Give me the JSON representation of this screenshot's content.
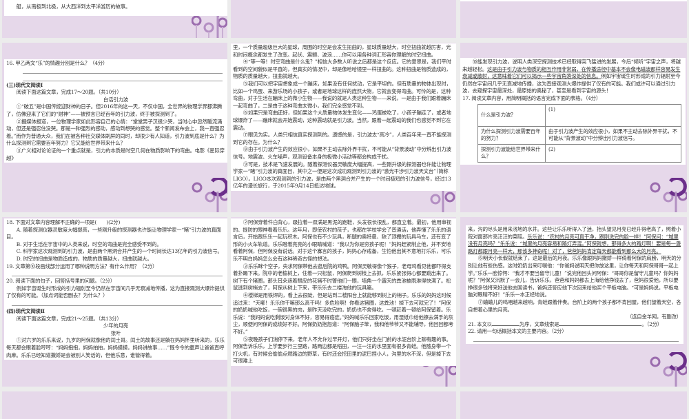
{
  "slides": {
    "s0a": {
      "text": "艇，从南极到北极，从大西洋到太平洋游历的故事。"
    },
    "s1a": {
      "q16": "16. 甲乙两文“乐”的情趣分别是什么？（4分）",
      "section": "(三)现代文阅读Ⅰ",
      "intro": "阅读下面这篇文章，完成17～20题。（共10分）",
      "title": "白话引力波",
      "p1": "①“破五”是中国传统迎财神的日子。但2016年的这一天，不仅中国，全世界的物理学界都沸腾了，仿佛迎来了它们的“财神”——被预言已经百年的引力波，终于被探测到了。",
      "p2": "②据媒体报道，一位物理学家如此形容自己的心情：“堂堂男子汉很少哭，当时心中忽然暖流涌动，但还是强忍住没哭。那是一种强烈的感动，感动到想哭的感觉。整个新闻发布会上，我一直强忍着。”而作为普通大众，我们在被各种社交媒体刷屏的同时，却很少有人知道，引力波到底是什么？为什么探测到它需要百年努力？它又能给世界带来什么？",
      "p3": "③广义相对论论证的一个重点就是，引力的本质是时空几何在物质影响下的弯曲。电影《星际穿越》"
    },
    "s1b": {
      "p0": "里，一个质量超级巨大的星球，周围的时空是会发生扭曲的，星球质量越大，时空扭曲就越厉害，光和时间概念都发生了改变。起伏、震颤、波浪……你可以用各种词汇形容你理解的时空扭曲。",
      "p4": "④“等一等！时空弯曲是什么鬼？”相信大多数人听说之后都是这个反应。它的意思是，我们平时看到的空间貌似是平直的，但真实的情况中，却是像哈哈镜里一样扭曲的。这种扭曲是物质造成的，物质的质量越大，扭曲就越大。",
      "p5": "⑤我们可以把宇宙想象成一个蹦床，如果没有任何扰动，它是平坦的。但有质量的物体出现时，比如一个鸡蛋、来游乐场的小孩子，或者是地球这样的庞然大物，它就会变得弯曲。可怜的是，这种弯曲，对于生活在蹦床上的微小生物——我说的就是人类这种生物——来说，一是由于我们跟着蹦床一起弯曲了，二是由于这种弯曲太微小，我们完全感觉不到。",
      "p6": "⑥如果只是弯曲还好，但如果这个大质量物体发生变化——鸡蛋被吃了，小孩子蹦走了，或者地球爆炸了——蹦床就会开始震动，这种震动就是引力波。当然，跟着一起震动的我们也感觉不到它在震动。",
      "p7": "⑦眼见为实。人类只相信真实探测到的。遗憾的是，引力波太“高冷”，人类百年来一直不能探测到它的存在。为什么？",
      "p8": "⑧由于引力波产生的效应很小，如果不主动去除外界干扰，不可能从“背景波动”中分辨出引力波信号。地震波、火车噪声，观测设备本身的极微小活动等都会构成干扰。",
      "p9": "⑨可是，技术是飞速发展的。随着探测仪器灵敏度大幅提高，一些刚升级的探测器也许能让物理学家一“睹”引力波的真面目，其中之一便是这次成功观测到引力波的“激光干涉引力波天文台”（简称LIGO）。LIGO本次观测到的引力波，是由两个黑洞合并产生的一个时间极短的引力波信号，经过13亿年的漫长旅行，于2015年9月14日抵达地球。"
    },
    "s1c": {
      "p10a": "⑩能发现引力波，说明人类深空探测技术已经取得突飞猛进的发展，今后“倾听”宇宙之声，将越来越轻松。",
      "p10u": "这是由于引力波与物质的相互作用非常弱，在传播途径中基本不会像电磁波那样容易发生衰减或散射，这意味着它们可以揭示一些宇宙角落深处的信息。",
      "p10b": "例如宇宙诞生时形成的引力辐射至今仍然在宇宙间几乎无衰减地传播，这为直接观测大爆炸提供了仅有的可能。我们或许可以通过引力波，去窥探宇宙最深处，最原始的奥秘了，甚至是看到宇宙的源头！",
      "q17": "17. 阅读文章内容，用简明概括的语言完成下面的表格。（4分）",
      "table": [
        {
          "q": "什么是引力波？",
          "a": "(1)"
        },
        {
          "q": "为什么探测引力波需要百年的努力？",
          "a": "由于引力波产生的效应很小，如果不主动去除外界干扰，不可能从“背景波动”中分辨出引力波信号。"
        },
        {
          "q": "探测引力波能给世界带来什么？",
          "a": "(2)"
        }
      ]
    },
    "s2a": {
      "q18": "18. 下面对文章内容理解不正确的一项是(　　)(2分)",
      "opts": [
        "A. 随着探测仪器灵敏度大幅提高，一些刚升级的探测器也许能让物理学家一“睹”引力波的真面目。",
        "B. 对于生活在宇宙中的人类来说，时空的弯曲是完全感受不到的。",
        "C. 科学家这次观测到的引力波，是由两个黑洞合并产生的一个时间长达13亿年的引力波信号。",
        "D. 时空的扭曲是物质造成的，物质的质量越大，扭曲就越大。"
      ],
      "q19": "19. 文章第⑩段画线部分运用了哪种说明方法？有什么作用？（2分）",
      "q20": "20. 阅读下面的句子，回答括号里的问题。（2分）",
      "q20s": "例如宇宙诞生时形成的引力辐射至今仍然在宇宙间几乎无衰减地传播，这为直接观测大爆炸提供了仅有的可能。（加点词能否删去？为什么？）",
      "section": "(四)现代文阅读Ⅱ",
      "intro": "阅读下面这篇文章，完成21～25题。（共13分）",
      "title": "少年的月亮",
      "author": "张叶",
      "p1": "①对六岁的乐乐来说，九岁的阿保就像他的闰土哥。闰土的故事还是躺在妈妈怀里听来的，乐乐每天都会眼着脸哼哼：“妈妈抱抱，妈妈拍拍，妈妈摸摸，妈妈讲故事……”既令令的童声让爸爸直呼肉麻。乐乐已经知道撒娇是会被别人笑话的，但他乐意，谁管得着。"
    },
    "s2b": {
      "p2": "②阿保穿着件白背心，趿拉着一双满是黑泥的跑鞋，头发很长很乱，都直立着。最初，他用审视的、提防的眼神看着乐乐。这年月，即使农村的孩子，也都在学校学会了普通话，他弄懂了乐乐的语言后，开始跟乐乐一起玩积木。阿保也有不少玩具，断腿的奥特曼、缺了顶棚的玩具马车，还有变了形的小火车轨道。乐乐瞪着亮亮的小眼睛喊道：“我以为你是穷孩子呢！”妈妈赶紧制止他，并不安地看着阿保，但阿保没有说话。对于这个寡言的孩子，妈妈心存戒备，生怕他出其不意地打乐乐，可乐乐不明白妈妈怎么会有这种稀奇古怪的想法。",
      "p3": "③乐乐眯个空子，央求阿保带他去逛后院的鸡鸭。阿保灵敏得像个猴子，老母鸡看见他都吓得支着扑踢下来。院中的老榆树上，住着一只松鼠，阿保爬到树枝上去抓，乐乐紧张得心都要跳出来了。树下有个猪圈，那头耳朵遮着眼皮的花猪不时瞥他们一眼，墙角一个露天的粪池被雨淋得快满了。松鼠逃到树梢去了，阿保从树上下来，带乐乐去二楼淘他的玩具箱。",
      "p4": "④楼梯是用铁焊的，看上去很陡，但是站到二楼阳台上就能够到树上的梢子。乐乐的妈妈这时候追过来：“天哪！乐乐你干嘛那么高干吗！多危险啊！你看这猪圈，这粪池！掉下去可就完了！”阿保的奶奶喊他吃饭，一碗很黑的肉，是昨天没吃完的，奶奶也不舍得吃，一顿赶着一顿给阿保留着。乐乐说：“我妈妈说吃剩饭对身体不好，容易得癌症。”妈妈喊乐乐回家吃饭，用湿纸巾给他擦去满手的灰尘，顺便问阿保的成绩好不好。阿保奶奶抱怨道：“阿保脑子笨，我和他爷爷又不能辅导，他回回都考不好。”",
      "p5": "⑤夜晚孩子们消停下来，老年人不允许过早开灯，他们只好坐在门前的水泥台阶上聊有趣的事。阿保告诉乐乐，上学要步行三里路，路两边都是稻田，一汪一汪的水里面有很多青蛙。他随身带一个打火机，有时候会偷偷点燃路边的野草，有时还会挖田里的泥巴捏小人，沟里的水不深，但是掉下去可很难上"
    },
    "s2c": {
      "p5b": "来，沟的尽头是用来浇地的水井。这些让乐乐听得入了迷，抬头望见月亮已经升得老高了，照着小院对面那片亮汪汪的菜畦。",
      "p5u": "乐乐说：“农村的月亮可真干净，跟刚洗完的脸一样！”阿保问：“城里没有月亮吗？”乐乐说：“城里的月亮容易和路灯弄混。”阿保就想，那得多大的路灯啊！要是每一盏路灯都跟月亮一样大，那该多神奇呢！对了，爸爸妈妈肯定每天都能看到那么大的月亮。",
      "p6": "⑥明天小长假就结束了，这是最后的月夜。乐乐像跟妈妈撒娇一样倚着阿保的肩膀，明天的分别让他有些伤感。这时奶奶出来叮嘱他：“你爸妈说明天把你放这里，让你每天和阿保哥哥一起上学。”乐乐一脸惊愕：“我才不要当留守儿童！”说完他回头问阿保：“哥哥你是留守儿童吗？你妈妈呢？”阿保又沉默了一会儿，告诉乐乐，爸爸和妈妈都去上海给他挣钱去了，爸妈很爱他，所以要挣很多钱将来好送他去国读书，爸妈还答应他下次回来给他买个平板电脑。“可是妈妈说，平板电脑对眼睛不好！”乐乐一本正经地说。",
      "p7": "⑦蛐蛐儿的鸣唱越来越响，青蛙跟着伴奏。台阶上的两个孩子都不肯回屋，他们望着天空，各自想着心里的月亮。",
      "source": "（选自金羊网，有删改）",
      "q21a": "21. 本文以",
      "q21b": "为序，文章线索是",
      "q21c": "。（2分）",
      "q22": "22. 请用一句话概括本文的主要内容。（2分）"
    }
  },
  "colors": {
    "slide_bg": "#e6d8ea",
    "accent": "#7a3f97",
    "gap": "#ececec"
  }
}
